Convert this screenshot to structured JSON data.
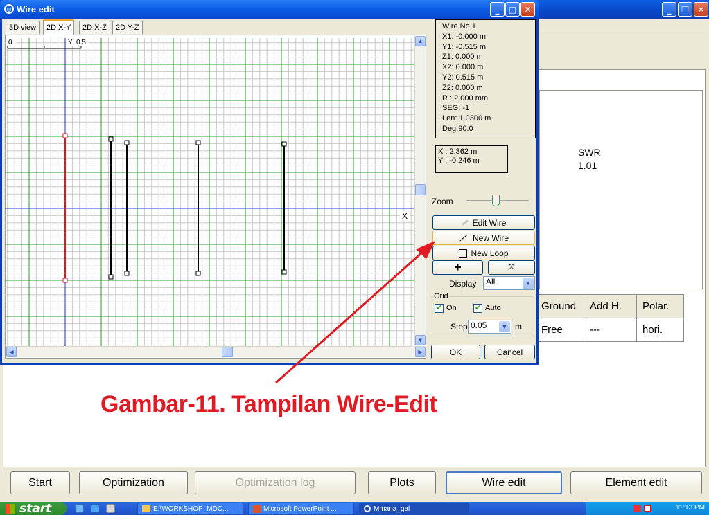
{
  "background_window": {
    "swr_label": "SWR",
    "swr_value": "1.01",
    "table": {
      "headers": [
        "Ground",
        "Add H.",
        "Polar."
      ],
      "row": [
        "Free",
        "---",
        "hori."
      ]
    },
    "bottom_buttons": [
      {
        "label": "Start",
        "state": "normal"
      },
      {
        "label": "Optimization",
        "state": "normal"
      },
      {
        "label": "Optimization log",
        "state": "disabled"
      },
      {
        "label": "Plots",
        "state": "normal"
      },
      {
        "label": "Wire edit",
        "state": "active"
      },
      {
        "label": "Element edit",
        "state": "normal"
      }
    ]
  },
  "dialog": {
    "title": "Wire edit",
    "tabs": [
      "3D view",
      "2D X-Y",
      "2D X-Z",
      "2D Y-Z"
    ],
    "active_tab": "2D X-Y",
    "plot": {
      "scale_label_left": "0",
      "scale_label_right": "0.5",
      "axis_y_label": "Y",
      "axis_x_label": "X"
    },
    "info": {
      "wire_no": "Wire No.1",
      "x1": "X1: -0.000 m",
      "y1": "Y1: -0.515 m",
      "z1": "Z1: 0.000 m",
      "x2": "X2: 0.000 m",
      "y2": "Y2: 0.515 m",
      "z2": "Z2: 0.000 m",
      "r": "R : 2.000 mm",
      "seg": "SEG: -1",
      "len": "Len: 1.0300 m",
      "deg": "Deg:90.0"
    },
    "cursor": {
      "x": "X : 2.362 m",
      "y": "Y : -0.246 m"
    },
    "zoom_label": "Zoom",
    "buttons": {
      "edit_wire": "Edit Wire",
      "new_wire": "New Wire",
      "new_loop": "New Loop",
      "plus": "+",
      "ok": "OK",
      "cancel": "Cancel"
    },
    "display_label": "Display",
    "display_value": "All",
    "grid": {
      "legend": "Grid",
      "on_label": "On",
      "auto_label": "Auto",
      "step_label": "Step",
      "step_value": "0.05",
      "step_unit": "m"
    }
  },
  "caption": "Gambar-11. Tampilan Wire-Edit",
  "taskbar": {
    "start": "start",
    "items": [
      "E:\\WORKSHOP_MDC...",
      "Microsoft PowerPoint ...",
      "Mmana_gal"
    ],
    "clock": "11:13 PM"
  },
  "colors": {
    "selected_wire": "#e8141c",
    "wire": "#000000",
    "major_grid": "#1fa01f",
    "minor_grid": "#c8c8c8",
    "axis": "#1c2bd8",
    "caption": "#e01b24"
  }
}
